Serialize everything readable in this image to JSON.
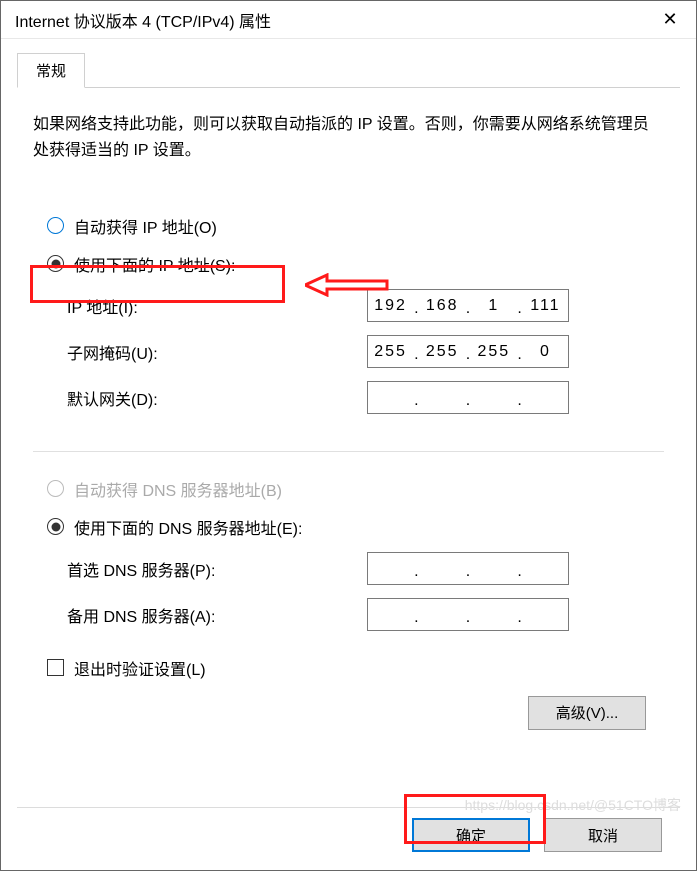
{
  "window": {
    "title": "Internet 协议版本 4 (TCP/IPv4) 属性"
  },
  "tab": {
    "general": "常规"
  },
  "intro_text": "如果网络支持此功能，则可以获取自动指派的 IP 设置。否则，你需要从网络系统管理员处获得适当的 IP 设置。",
  "ip_section": {
    "auto_label": "自动获得 IP 地址(O)",
    "manual_label": "使用下面的 IP 地址(S):",
    "ip_label": "IP 地址(I):",
    "subnet_label": "子网掩码(U):",
    "gateway_label": "默认网关(D):",
    "ip_value": {
      "o1": "192",
      "o2": "168",
      "o3": "1",
      "o4": "111"
    },
    "subnet_value": {
      "o1": "255",
      "o2": "255",
      "o3": "255",
      "o4": "0"
    },
    "gateway_value": {
      "o1": "",
      "o2": "",
      "o3": "",
      "o4": ""
    }
  },
  "dns_section": {
    "auto_label": "自动获得 DNS 服务器地址(B)",
    "manual_label": "使用下面的 DNS 服务器地址(E):",
    "preferred_label": "首选 DNS 服务器(P):",
    "alternate_label": "备用 DNS 服务器(A):",
    "preferred_value": {
      "o1": "",
      "o2": "",
      "o3": "",
      "o4": ""
    },
    "alternate_value": {
      "o1": "",
      "o2": "",
      "o3": "",
      "o4": ""
    }
  },
  "validate_checkbox_label": "退出时验证设置(L)",
  "advanced_button": "高级(V)...",
  "ok_button": "确定",
  "cancel_button": "取消",
  "watermark": "https://blog.csdn.net/@51CTO博客"
}
